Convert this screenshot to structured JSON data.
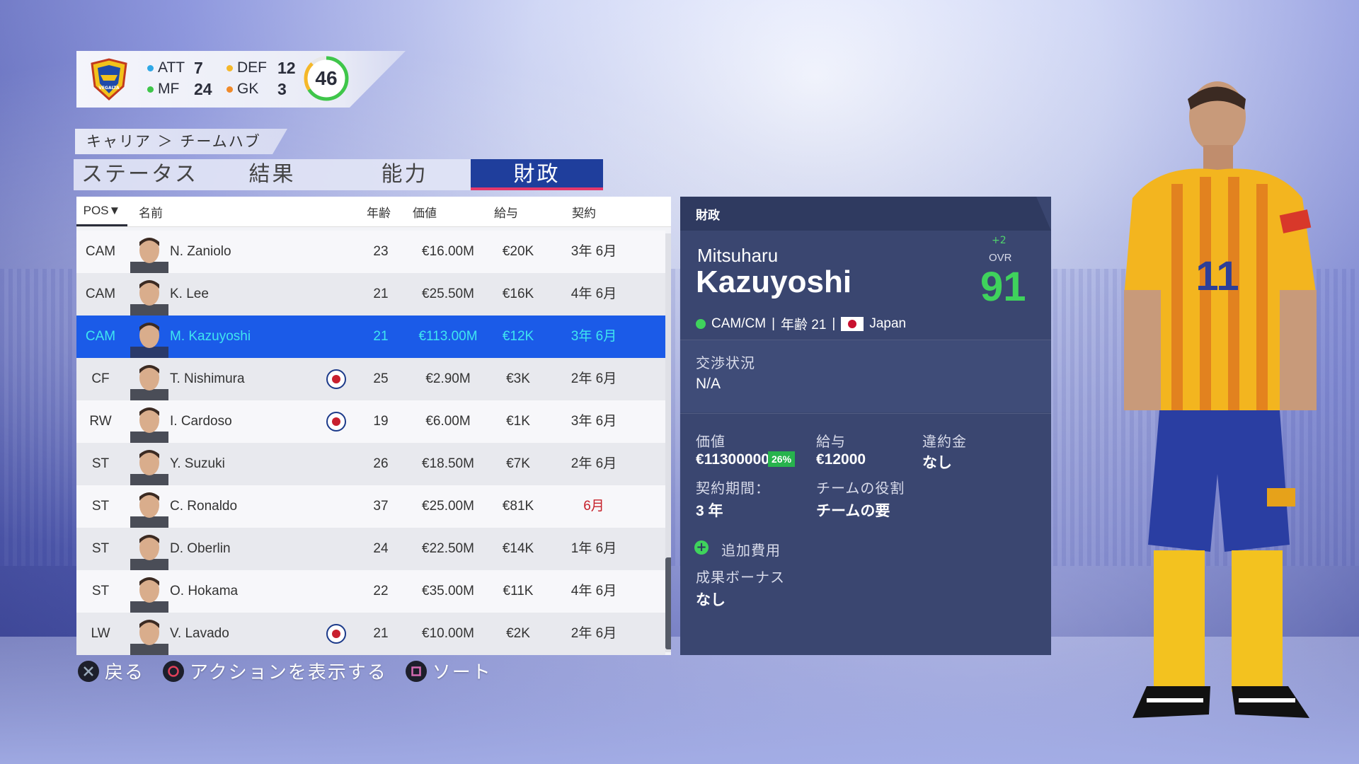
{
  "team": {
    "crest_icon": "vegalta-crest-icon",
    "crest_text": "VEGALTA",
    "positions": [
      {
        "label": "ATT",
        "count": "7",
        "color": "#2fa8e6"
      },
      {
        "label": "DEF",
        "count": "12",
        "color": "#f5b82a"
      },
      {
        "label": "MF",
        "count": "24",
        "color": "#3fc64a"
      },
      {
        "label": "GK",
        "count": "3",
        "color": "#f08a2a"
      }
    ],
    "ovr": "46"
  },
  "breadcrumb": "キャリア ＞ チームハブ",
  "tabs": [
    {
      "label": "ステータス",
      "active": false
    },
    {
      "label": "結果",
      "active": false
    },
    {
      "label": "能力",
      "active": false
    },
    {
      "label": "財政",
      "active": true
    }
  ],
  "table": {
    "headers": {
      "pos": "POS▼",
      "name": "名前",
      "age": "年齢",
      "value": "価値",
      "wage": "給与",
      "contract": "契約"
    },
    "rows": [
      {
        "pos": "CAM",
        "name": "N. Zaniolo",
        "club_icon": "",
        "age": "23",
        "value": "€16.00M",
        "wage": "€20K",
        "contract": "3年 6月"
      },
      {
        "pos": "CAM",
        "name": "K. Lee",
        "club_icon": "",
        "age": "21",
        "value": "€25.50M",
        "wage": "€16K",
        "contract": "4年 6月"
      },
      {
        "pos": "CAM",
        "name": "M. Kazuyoshi",
        "club_icon": "",
        "age": "21",
        "value": "€113.00M",
        "wage": "€12K",
        "contract": "3年 6月",
        "selected": true
      },
      {
        "pos": "CF",
        "name": "T. Nishimura",
        "club_icon": "copenhagen-crest-icon",
        "age": "25",
        "value": "€2.90M",
        "wage": "€3K",
        "contract": "2年 6月"
      },
      {
        "pos": "RW",
        "name": "I. Cardoso",
        "club_icon": "club-shield-icon",
        "age": "19",
        "value": "€6.00M",
        "wage": "€1K",
        "contract": "3年 6月"
      },
      {
        "pos": "ST",
        "name": "Y. Suzuki",
        "club_icon": "",
        "age": "26",
        "value": "€18.50M",
        "wage": "€7K",
        "contract": "2年 6月"
      },
      {
        "pos": "ST",
        "name": "C. Ronaldo",
        "club_icon": "",
        "age": "37",
        "value": "€25.00M",
        "wage": "€81K",
        "contract": "6月",
        "expiring": true
      },
      {
        "pos": "ST",
        "name": "D. Oberlin",
        "club_icon": "",
        "age": "24",
        "value": "€22.50M",
        "wage": "€14K",
        "contract": "1年 6月"
      },
      {
        "pos": "ST",
        "name": "O. Hokama",
        "club_icon": "",
        "age": "22",
        "value": "€35.00M",
        "wage": "€11K",
        "contract": "4年 6月"
      },
      {
        "pos": "LW",
        "name": "V. Lavado",
        "club_icon": "fenerbahce-crest-icon",
        "age": "21",
        "value": "€10.00M",
        "wage": "€2K",
        "contract": "2年 6月"
      }
    ]
  },
  "detail": {
    "header": "財政",
    "first_name": "Mitsuharu",
    "last_name": "Kazuyoshi",
    "ovr_change": "+2",
    "ovr_label": "OVR",
    "ovr": "91",
    "positions": "CAM/CM",
    "age_label": "年齢 21",
    "nation": "Japan",
    "negotiation_label": "交渉状況",
    "negotiation_value": "N/A",
    "value_label": "価値",
    "value": "€113000000",
    "value_change": "26%",
    "wage_label": "給与",
    "wage": "€12000",
    "release_label": "違約金",
    "release": "なし",
    "contract_label": "契約期間：",
    "contract": "3 年",
    "role_label": "チームの役割",
    "role": "チームの要",
    "extra_label": "追加費用",
    "bonus_label": "成果ボーナス",
    "bonus": "なし"
  },
  "controls": [
    {
      "icon": "cross-button-icon",
      "label": "戻る"
    },
    {
      "icon": "circle-button-icon",
      "label": "アクションを表示する"
    },
    {
      "icon": "square-button-icon",
      "label": "ソート"
    }
  ],
  "colors": {
    "accent": "#1f3e9c",
    "selected_row": "#1b5be8",
    "ovr_green": "#3fd35c",
    "panel": "#3a4670"
  }
}
